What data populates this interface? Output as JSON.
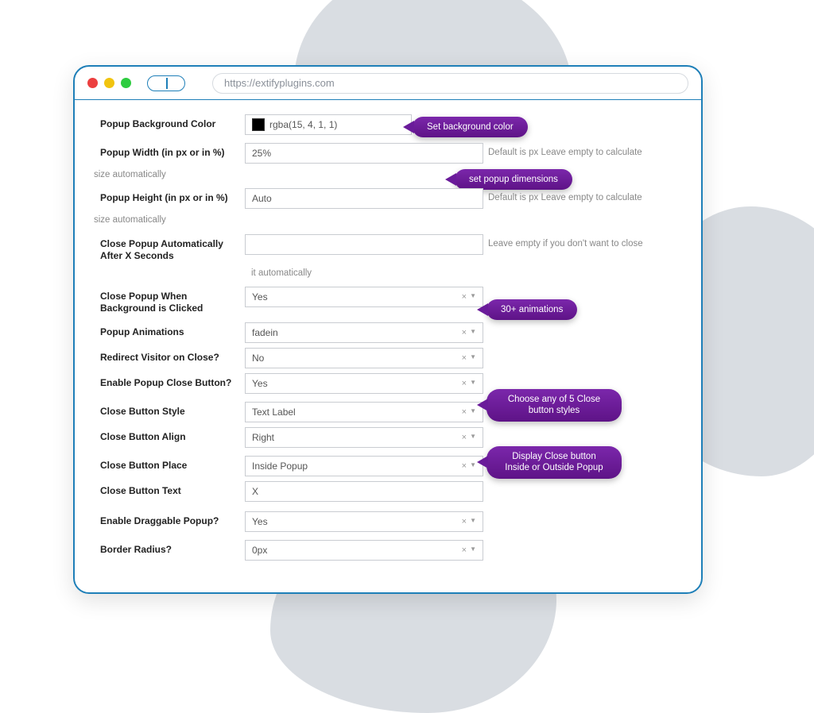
{
  "url": "https://extifyplugins.com",
  "labels": {
    "bg_color": "Popup Background Color",
    "width": "Popup Width (in px or in %)",
    "height": "Popup Height (in px or in %)",
    "auto_close": "Close Popup Automatically After X Seconds",
    "bg_click": "Close Popup When Background is Clicked",
    "animations": "Popup Animations",
    "redirect": "Redirect Visitor on Close?",
    "enable_close": "Enable Popup Close Button?",
    "close_style": "Close Button Style",
    "close_align": "Close Button Align",
    "close_place": "Close Button Place",
    "close_text": "Close Button Text",
    "draggable": "Enable Draggable Popup?",
    "radius": "Border Radius?"
  },
  "values": {
    "bg_color": "rgba(15, 4, 1, 1)",
    "width": "25%",
    "height": "Auto",
    "auto_close": "",
    "bg_click": "Yes",
    "animations": "fadein",
    "redirect": "No",
    "enable_close": "Yes",
    "close_style": "Text Label",
    "close_align": "Right",
    "close_place": "Inside Popup",
    "close_text": "X",
    "draggable": "Yes",
    "radius": "0px"
  },
  "hints": {
    "px_default": "Default is px Leave empty to calculate",
    "size_auto": "size automatically",
    "auto_close_below": "it automatically",
    "auto_close_right": "Leave empty if you don't want to close"
  },
  "callouts": {
    "bg": "Set background color",
    "dims": "set popup dimensions",
    "anim": "30+ animations",
    "style": "Choose any of 5 Close button styles",
    "place": "Display Close button Inside or Outside Popup"
  }
}
